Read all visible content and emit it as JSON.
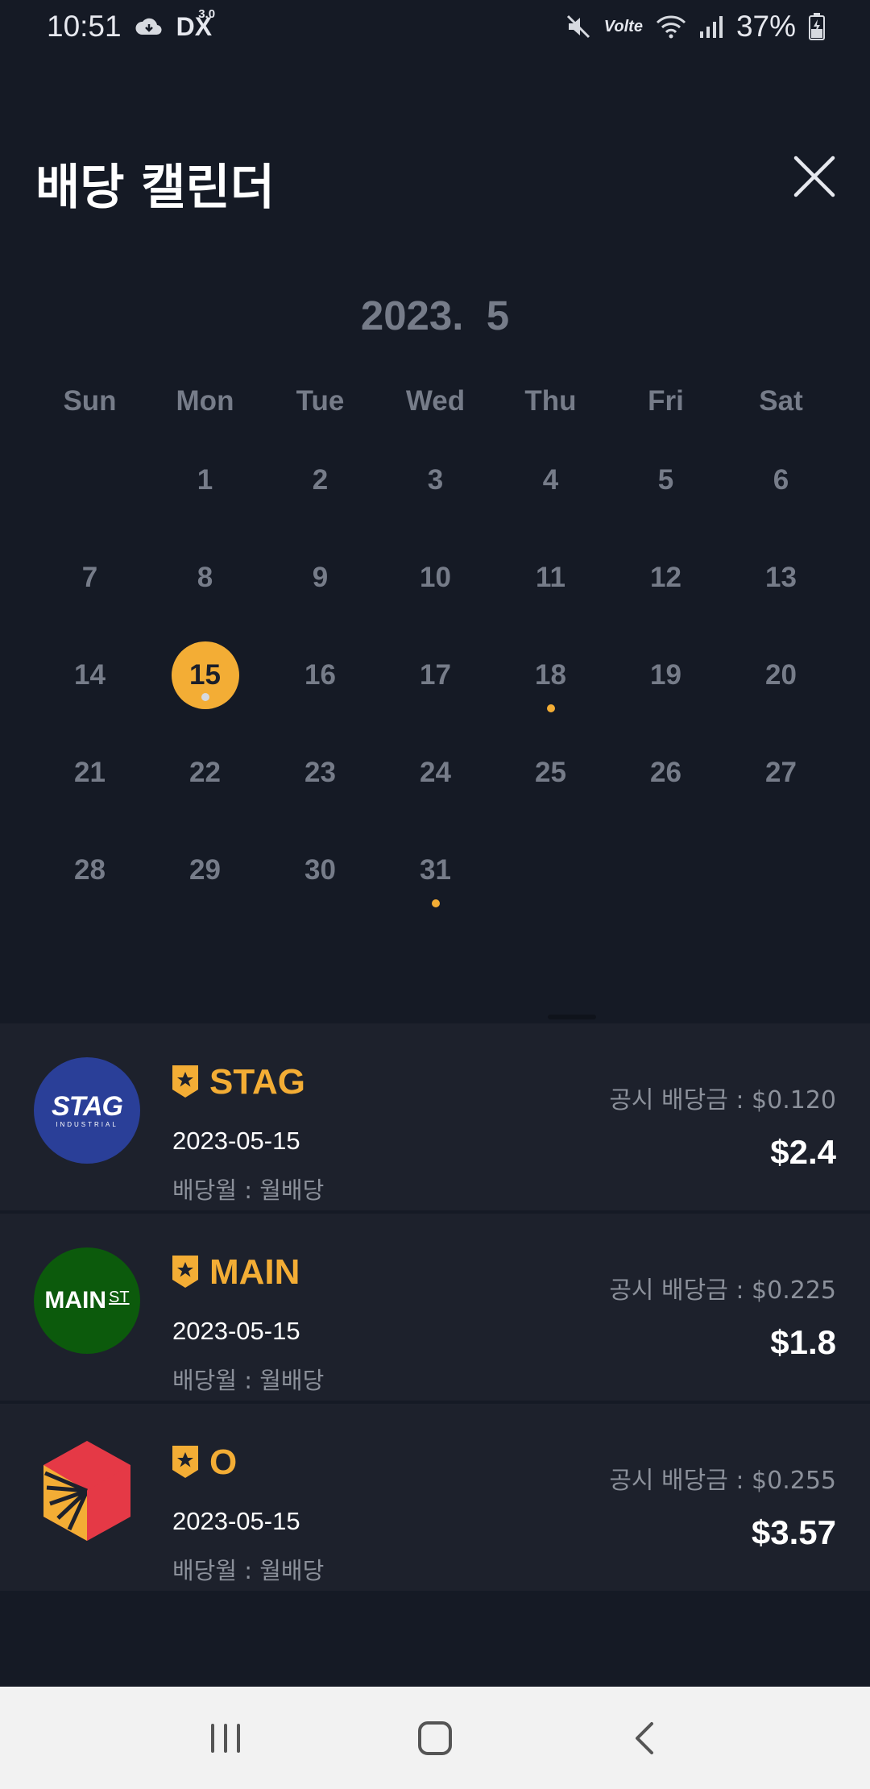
{
  "status_bar": {
    "time": "10:51",
    "battery": "37%",
    "dx_label": "DX",
    "dx_version": "3.0",
    "network": "Volte",
    "icons": [
      "cloud-icon",
      "mute-icon",
      "wifi-icon",
      "signal-icon",
      "battery-icon"
    ]
  },
  "header": {
    "title": "배당 캘린더",
    "close_icon": "close-icon"
  },
  "calendar": {
    "month_label": "2023.  5",
    "weekdays": [
      "Sun",
      "Mon",
      "Tue",
      "Wed",
      "Thu",
      "Fri",
      "Sat"
    ],
    "leading_blanks": 1,
    "days": [
      "1",
      "2",
      "3",
      "4",
      "5",
      "6",
      "7",
      "8",
      "9",
      "10",
      "11",
      "12",
      "13",
      "14",
      "15",
      "16",
      "17",
      "18",
      "19",
      "20",
      "21",
      "22",
      "23",
      "24",
      "25",
      "26",
      "27",
      "28",
      "29",
      "30",
      "31"
    ],
    "selected_day": "15",
    "marked_days": [
      "15",
      "18",
      "31"
    ]
  },
  "dividends": [
    {
      "ticker": "STAG",
      "logo_text": "STAG",
      "logo_subtext": "INDUSTRIAL",
      "date": "2023-05-15",
      "month_type": "배당월 : 월배당",
      "announced": "공시 배당금 : $0.120",
      "amount": "$2.4"
    },
    {
      "ticker": "MAIN",
      "logo_text": "MAIN",
      "logo_subtext": "ST",
      "date": "2023-05-15",
      "month_type": "배당월 : 월배당",
      "announced": "공시 배당금 : $0.225",
      "amount": "$1.8"
    },
    {
      "ticker": "O",
      "date": "2023-05-15",
      "month_type": "배당월 : 월배당",
      "announced": "공시 배당금 : $0.255",
      "amount": "$3.57"
    }
  ],
  "colors": {
    "accent": "#f3ad35",
    "background": "#151a25",
    "card": "#1d212c",
    "muted": "#767c89"
  },
  "nav_bar": {
    "icons": [
      "recent-apps-icon",
      "home-icon",
      "back-icon"
    ]
  }
}
